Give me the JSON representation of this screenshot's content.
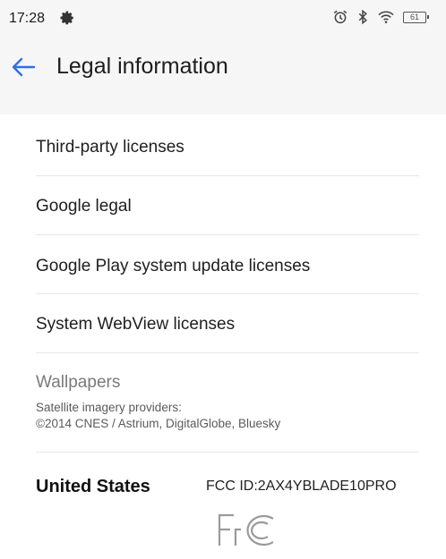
{
  "status_bar": {
    "time": "17:28",
    "battery": "61",
    "icons": [
      "settings-gear-icon",
      "alarm-icon",
      "bluetooth-icon",
      "wifi-icon",
      "battery-icon"
    ]
  },
  "header": {
    "title": "Legal information",
    "back_icon": "back-arrow-icon",
    "accent": "#2f6fe4"
  },
  "menu": {
    "items": [
      {
        "label": "Third-party licenses"
      },
      {
        "label": "Google legal"
      },
      {
        "label": "Google Play system update licenses"
      },
      {
        "label": "System WebView licenses"
      }
    ]
  },
  "wallpapers": {
    "label": "Wallpapers",
    "line1": "Satellite imagery providers:",
    "line2": "©2014 CNES / Astrium, DigitalGlobe, Bluesky"
  },
  "regulatory": {
    "country": "United States",
    "fcc_id": "FCC ID:2AX4YBLADE10PRO",
    "logo": "fcc-logo"
  }
}
